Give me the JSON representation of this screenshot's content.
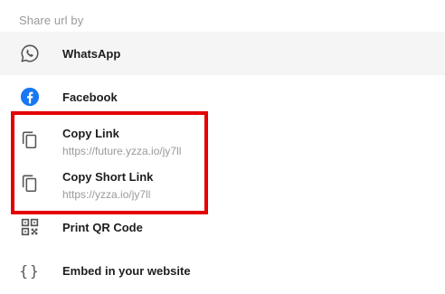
{
  "header": {
    "title": "Share url by"
  },
  "items": [
    {
      "label": "WhatsApp",
      "icon": "whatsapp-icon"
    },
    {
      "label": "Facebook",
      "icon": "facebook-icon"
    },
    {
      "label": "Copy Link",
      "sublabel": "https://future.yzza.io/jy7ll",
      "icon": "copy-icon"
    },
    {
      "label": "Copy Short Link",
      "sublabel": "https://yzza.io/jy7ll",
      "icon": "copy-icon"
    },
    {
      "label": "Print QR Code",
      "icon": "qr-code-icon"
    },
    {
      "label": "Embed in your website",
      "icon": "code-braces-icon"
    }
  ],
  "colors": {
    "facebook_blue": "#1877f2",
    "highlight_red": "#e40000",
    "hover_bg": "#f5f5f5"
  }
}
